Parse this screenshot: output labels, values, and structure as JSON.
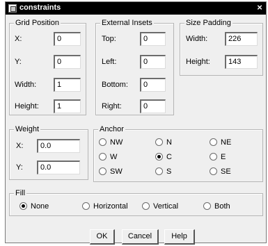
{
  "window": {
    "title": "constraints",
    "close_glyph": "×",
    "icon": "window-icon"
  },
  "grid_position": {
    "legend": "Grid Position",
    "fields": [
      {
        "label": "X:",
        "value": "0"
      },
      {
        "label": "Y:",
        "value": "0"
      },
      {
        "label": "Width:",
        "value": "1"
      },
      {
        "label": "Height:",
        "value": "1"
      }
    ]
  },
  "external_insets": {
    "legend": "External Insets",
    "fields": [
      {
        "label": "Top:",
        "value": "0"
      },
      {
        "label": "Left:",
        "value": "0"
      },
      {
        "label": "Bottom:",
        "value": "0"
      },
      {
        "label": "Right:",
        "value": "0"
      }
    ]
  },
  "size_padding": {
    "legend": "Size Padding",
    "fields": [
      {
        "label": "Width:",
        "value": "226"
      },
      {
        "label": "Height:",
        "value": "143"
      }
    ]
  },
  "weight": {
    "legend": "Weight",
    "fields": [
      {
        "label": "X:",
        "value": "0.0"
      },
      {
        "label": "Y:",
        "value": "0.0"
      }
    ]
  },
  "anchor": {
    "legend": "Anchor",
    "options": [
      "NW",
      "N",
      "NE",
      "W",
      "C",
      "E",
      "SW",
      "S",
      "SE"
    ],
    "selected": "C"
  },
  "fill": {
    "legend": "Fill",
    "options": [
      "None",
      "Horizontal",
      "Vertical",
      "Both"
    ],
    "selected": "None"
  },
  "buttons": {
    "ok": "OK",
    "cancel": "Cancel",
    "help": "Help"
  }
}
